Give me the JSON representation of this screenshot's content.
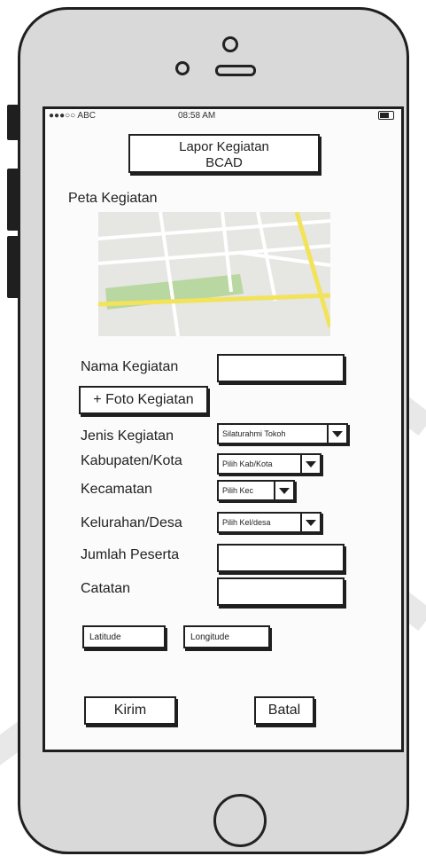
{
  "status": {
    "carrier": "●●●○○ ABC",
    "time": "08:58 AM"
  },
  "header": {
    "title_line1": "Lapor Kegiatan",
    "title_line2": "BCAD"
  },
  "map": {
    "label": "Peta Kegiatan"
  },
  "form": {
    "nama_kegiatan_label": "Nama Kegiatan",
    "nama_kegiatan_value": "",
    "foto_button": "+ Foto Kegiatan",
    "jenis_label": "Jenis Kegiatan",
    "jenis_value": "Silaturahmi Tokoh",
    "kabupaten_label": "Kabupaten/Kota",
    "kabupaten_value": "Pilih Kab/Kota",
    "kecamatan_label": "Kecamatan",
    "kecamatan_value": "Pilih Kec",
    "kelurahan_label": "Kelurahan/Desa",
    "kelurahan_value": "Pilih Kel/desa",
    "jumlah_label": "Jumlah Peserta",
    "jumlah_value": "",
    "catatan_label": "Catatan",
    "catatan_value": "",
    "latitude": "Latitude",
    "longitude": "Longitude"
  },
  "actions": {
    "submit": "Kirim",
    "cancel": "Batal"
  },
  "colors": {
    "road_yellow": "#f2e35a",
    "park_green": "#b9d7a0",
    "map_bg": "#e6e6e3",
    "phone_body": "#d9d9d9"
  }
}
